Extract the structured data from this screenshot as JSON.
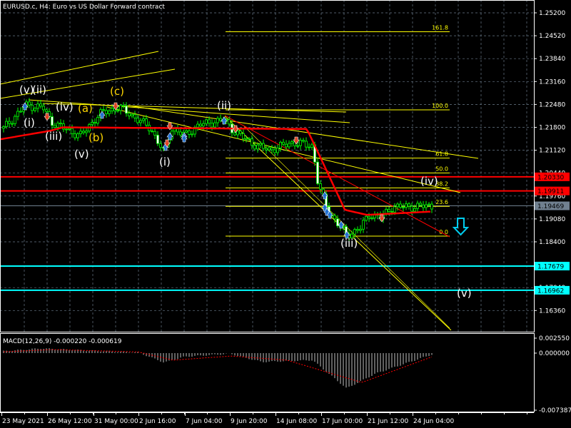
{
  "window": {
    "symbol_title": "EURUSD.c, H4:  Euro vs US Dollar Forward contract"
  },
  "colors": {
    "background": "#000000",
    "grid": "#6a7a8a",
    "candle": "#00ff00",
    "moving_average": "#ff0000",
    "trendline": "#ffff00",
    "support_resistance": "#ff0000",
    "target_line": "#00ffff",
    "current_price_box": "#708090",
    "wave_label_white": "#ffffff",
    "wave_label_yellow": "#ffd700",
    "arrow_up": "#1e6fd0",
    "arrow_down": "#e04020"
  },
  "chart_data": {
    "type": "candlestick",
    "title": "EURUSD.c, H4:  Euro vs US Dollar Forward contract",
    "ylim": [
      1.1582,
      1.2554
    ],
    "grid": true,
    "y_ticks": [
      "1.25200",
      "1.24520",
      "1.23840",
      "1.23160",
      "1.22480",
      "1.21800",
      "1.21120",
      "1.20440",
      "1.19760",
      "1.19080",
      "1.18400",
      "1.17040",
      "1.16360"
    ],
    "x_ticks": [
      {
        "label": "23 May 2021",
        "time": "2021-05-23T00:00Z"
      },
      {
        "label": "26 May 12:00",
        "time": "2021-05-26T12:00Z"
      },
      {
        "label": "31 May 00:00",
        "time": "2021-05-31T00:00Z"
      },
      {
        "label": "2 Jun 16:00",
        "time": "2021-06-02T16:00Z"
      },
      {
        "label": "7 Jun 04:00",
        "time": "2021-06-07T04:00Z"
      },
      {
        "label": "9 Jun 20:00",
        "time": "2021-06-09T20:00Z"
      },
      {
        "label": "14 Jun 08:00",
        "time": "2021-06-14T08:00Z"
      },
      {
        "label": "17 Jun 00:00",
        "time": "2021-06-17T00:00Z"
      },
      {
        "label": "21 Jun 12:00",
        "time": "2021-06-21T12:00Z"
      },
      {
        "label": "24 Jun 04:00",
        "time": "2021-06-24T04:00Z"
      }
    ],
    "price_path": [
      {
        "time": "2021-05-23T04:00Z",
        "price": 1.2177
      },
      {
        "time": "2021-05-24T20:00Z",
        "price": 1.2245
      },
      {
        "time": "2021-05-26T04:00Z",
        "price": 1.224
      },
      {
        "time": "2021-05-26T20:00Z",
        "price": 1.2198
      },
      {
        "time": "2021-05-28T20:00Z",
        "price": 1.2166
      },
      {
        "time": "2021-05-29T20:00Z",
        "price": 1.2156
      },
      {
        "time": "2021-05-31T08:00Z",
        "price": 1.2219
      },
      {
        "time": "2021-06-01T12:00Z",
        "price": 1.224
      },
      {
        "time": "2021-06-02T04:00Z",
        "price": 1.2219
      },
      {
        "time": "2021-06-03T20:00Z",
        "price": 1.2177
      },
      {
        "time": "2021-06-05T04:00Z",
        "price": 1.2103
      },
      {
        "time": "2021-06-05T20:00Z",
        "price": 1.2177
      },
      {
        "time": "2021-06-07T04:00Z",
        "price": 1.2156
      },
      {
        "time": "2021-06-08T00:00Z",
        "price": 1.2187
      },
      {
        "time": "2021-06-09T12:00Z",
        "price": 1.2202
      },
      {
        "time": "2021-06-10T08:00Z",
        "price": 1.2166
      },
      {
        "time": "2021-06-12T12:00Z",
        "price": 1.2124
      },
      {
        "time": "2021-06-13T20:00Z",
        "price": 1.2113
      },
      {
        "time": "2021-06-15T08:00Z",
        "price": 1.2135
      },
      {
        "time": "2021-06-16T12:00Z",
        "price": 1.2124
      },
      {
        "time": "2021-06-16T20:00Z",
        "price": 1.2007
      },
      {
        "time": "2021-06-17T16:00Z",
        "price": 1.1933
      },
      {
        "time": "2021-06-19T12:00Z",
        "price": 1.1859
      },
      {
        "time": "2021-06-20T20:00Z",
        "price": 1.188
      },
      {
        "time": "2021-06-21T16:00Z",
        "price": 1.1923
      },
      {
        "time": "2021-06-22T08:00Z",
        "price": 1.1912
      },
      {
        "time": "2021-06-23T00:00Z",
        "price": 1.1944
      },
      {
        "time": "2021-06-24T00:00Z",
        "price": 1.1944
      },
      {
        "time": "2021-06-25T08:00Z",
        "price": 1.1947
      }
    ],
    "moving_average_path": [
      {
        "time": "2021-05-23T00:00Z",
        "price": 1.2145
      },
      {
        "time": "2021-05-26T20:00Z",
        "price": 1.217
      },
      {
        "time": "2021-05-28T00:00Z",
        "price": 1.218
      },
      {
        "time": "2021-06-16T04:00Z",
        "price": 1.2175
      },
      {
        "time": "2021-06-17T04:00Z",
        "price": 1.2075
      },
      {
        "time": "2021-06-19T08:00Z",
        "price": 1.1935
      },
      {
        "time": "2021-06-21T12:00Z",
        "price": 1.192
      },
      {
        "time": "2021-06-25T08:00Z",
        "price": 1.193
      }
    ],
    "horizontal_levels": [
      {
        "price": 1.2033,
        "label": "1.20330",
        "kind": "resistance"
      },
      {
        "price": 1.19911,
        "label": "1.19911",
        "kind": "resistance"
      },
      {
        "price": 1.19469,
        "label": "1.19469",
        "kind": "current"
      },
      {
        "price": 1.17679,
        "label": "1.17679",
        "kind": "target"
      },
      {
        "price": 1.16962,
        "label": "1.16962",
        "kind": "target"
      }
    ],
    "fibonacci": {
      "high": 1.2232,
      "low": 1.1857,
      "levels": [
        {
          "ratio": 1.618,
          "label": "161.8"
        },
        {
          "ratio": 1.0,
          "label": "100.0"
        },
        {
          "ratio": 0.618,
          "label": "61.8"
        },
        {
          "ratio": 0.5,
          "label": "50.0"
        },
        {
          "ratio": 0.382,
          "label": "38.2"
        },
        {
          "ratio": 0.236,
          "label": "23.6"
        },
        {
          "ratio": 0.0,
          "label": "0.0"
        }
      ]
    },
    "wave_labels": [
      "(v)",
      "(ii)",
      "(i)",
      "(iii)",
      "(iv)",
      "(v)",
      "(a)",
      "(b)",
      "(c)",
      "(ii)",
      "(i)",
      "(iii)",
      "(iv)",
      "(v)"
    ],
    "macd": {
      "label": "MACD(12,26,9) -0.000220 -0.000619",
      "ylim": [
        -0.007387,
        0.00255
      ],
      "y_ticks": [
        "0.002550",
        "0.000000",
        "-0.007387"
      ],
      "histogram_path": [
        {
          "time": "2021-05-23T00:00Z",
          "value": 0.0003
        },
        {
          "time": "2021-05-26T00:00Z",
          "value": 0.0008
        },
        {
          "time": "2021-05-31T00:00Z",
          "value": 0.0004
        },
        {
          "time": "2021-06-02T16:00Z",
          "value": 0.0001
        },
        {
          "time": "2021-06-05T04:00Z",
          "value": -0.0016
        },
        {
          "time": "2021-06-07T04:00Z",
          "value": -0.0006
        },
        {
          "time": "2021-06-09T20:00Z",
          "value": -0.0001
        },
        {
          "time": "2021-06-13T00:00Z",
          "value": -0.0015
        },
        {
          "time": "2021-06-16T12:00Z",
          "value": -0.0012
        },
        {
          "time": "2021-06-19T12:00Z",
          "value": -0.006
        },
        {
          "time": "2021-06-22T00:00Z",
          "value": -0.0035
        },
        {
          "time": "2021-06-25T08:00Z",
          "value": -0.0002
        }
      ],
      "signal_path": [
        {
          "time": "2021-05-23T00:00Z",
          "value": 0.0002
        },
        {
          "time": "2021-05-27T00:00Z",
          "value": 0.0006
        },
        {
          "time": "2021-06-02T16:00Z",
          "value": 0.0002
        },
        {
          "time": "2021-06-06T00:00Z",
          "value": -0.0012
        },
        {
          "time": "2021-06-10T00:00Z",
          "value": -0.0005
        },
        {
          "time": "2021-06-15T00:00Z",
          "value": -0.0012
        },
        {
          "time": "2021-06-21T00:00Z",
          "value": -0.005
        },
        {
          "time": "2021-06-25T08:00Z",
          "value": -0.0006
        }
      ]
    }
  }
}
